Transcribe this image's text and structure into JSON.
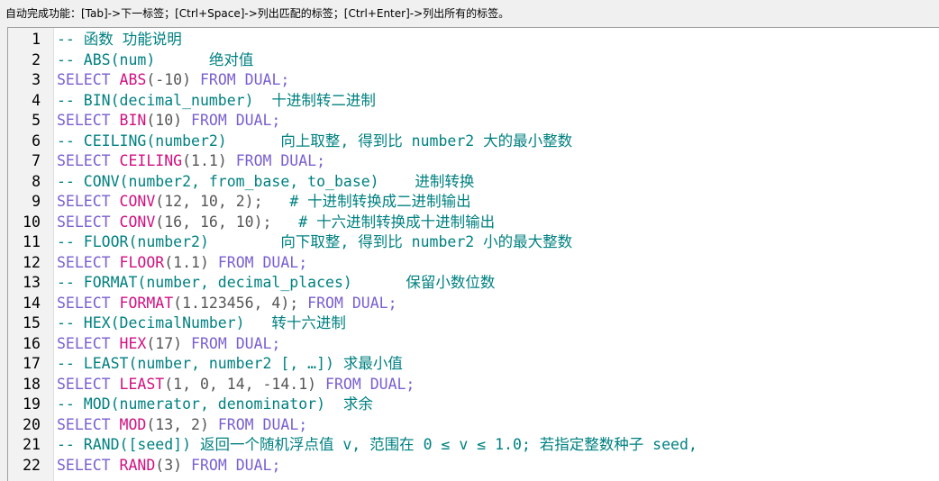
{
  "hint": "自动完成功能：[Tab]->下一标签；[Ctrl+Space]->列出匹配的标签；[Ctrl+Enter]->列出所有的标签。",
  "colors": {
    "comment": "#008080",
    "keyword": "#7a5fd0",
    "function": "#d01080",
    "text": "#555555"
  },
  "lines": [
    {
      "no": "1",
      "segs": [
        [
          "c",
          "-- 函数 功能说明"
        ]
      ]
    },
    {
      "no": "2",
      "segs": [
        [
          "c",
          "-- ABS(num)      绝对值"
        ]
      ]
    },
    {
      "no": "3",
      "segs": [
        [
          "k",
          "SELECT "
        ],
        [
          "f",
          "ABS"
        ],
        [
          "n",
          "(-10) "
        ],
        [
          "k",
          "FROM DUAL;"
        ]
      ]
    },
    {
      "no": "4",
      "segs": [
        [
          "c",
          "-- BIN(decimal_number)  十进制转二进制"
        ]
      ]
    },
    {
      "no": "5",
      "segs": [
        [
          "k",
          "SELECT "
        ],
        [
          "f",
          "BIN"
        ],
        [
          "n",
          "(10) "
        ],
        [
          "k",
          "FROM DUAL;"
        ]
      ]
    },
    {
      "no": "6",
      "segs": [
        [
          "c",
          "-- CEILING(number2)      向上取整, 得到比 number2 大的最小整数"
        ]
      ]
    },
    {
      "no": "7",
      "segs": [
        [
          "k",
          "SELECT "
        ],
        [
          "f",
          "CEILING"
        ],
        [
          "n",
          "(1.1) "
        ],
        [
          "k",
          "FROM DUAL;"
        ]
      ]
    },
    {
      "no": "8",
      "segs": [
        [
          "c",
          "-- CONV(number2, from_base, to_base)    进制转换"
        ]
      ]
    },
    {
      "no": "9",
      "segs": [
        [
          "k",
          "SELECT "
        ],
        [
          "f",
          "CONV"
        ],
        [
          "n",
          "(12, 10, 2);   "
        ],
        [
          "c",
          "# 十进制转换成二进制输出"
        ]
      ]
    },
    {
      "no": "10",
      "segs": [
        [
          "k",
          "SELECT "
        ],
        [
          "f",
          "CONV"
        ],
        [
          "n",
          "(16, 16, 10);   "
        ],
        [
          "c",
          "# 十六进制转换成十进制输出"
        ]
      ]
    },
    {
      "no": "11",
      "segs": [
        [
          "c",
          "-- FLOOR(number2)        向下取整, 得到比 number2 小的最大整数"
        ]
      ]
    },
    {
      "no": "12",
      "segs": [
        [
          "k",
          "SELECT "
        ],
        [
          "f",
          "FLOOR"
        ],
        [
          "n",
          "(1.1) "
        ],
        [
          "k",
          "FROM DUAL;"
        ]
      ]
    },
    {
      "no": "13",
      "segs": [
        [
          "c",
          "-- FORMAT(number, decimal_places)      保留小数位数"
        ]
      ]
    },
    {
      "no": "14",
      "segs": [
        [
          "k",
          "SELECT "
        ],
        [
          "f",
          "FORMAT"
        ],
        [
          "n",
          "(1.123456, 4); "
        ],
        [
          "k",
          "FROM DUAL;"
        ]
      ]
    },
    {
      "no": "15",
      "segs": [
        [
          "c",
          "-- HEX(DecimalNumber)   转十六进制"
        ]
      ]
    },
    {
      "no": "16",
      "segs": [
        [
          "k",
          "SELECT "
        ],
        [
          "f",
          "HEX"
        ],
        [
          "n",
          "(17) "
        ],
        [
          "k",
          "FROM DUAL;"
        ]
      ]
    },
    {
      "no": "17",
      "segs": [
        [
          "c",
          "-- LEAST(number, number2 [, …]) 求最小值"
        ]
      ]
    },
    {
      "no": "18",
      "segs": [
        [
          "k",
          "SELECT "
        ],
        [
          "f",
          "LEAST"
        ],
        [
          "n",
          "(1, 0, 14, -14.1) "
        ],
        [
          "k",
          "FROM DUAL;"
        ]
      ]
    },
    {
      "no": "19",
      "segs": [
        [
          "c",
          "-- MOD(numerator, denominator)  求余"
        ]
      ]
    },
    {
      "no": "20",
      "segs": [
        [
          "k",
          "SELECT "
        ],
        [
          "f",
          "MOD"
        ],
        [
          "n",
          "(13, 2) "
        ],
        [
          "k",
          "FROM DUAL;"
        ]
      ]
    },
    {
      "no": "21",
      "segs": [
        [
          "c",
          "-- RAND([seed]) 返回一个随机浮点值 v, 范围在 0 ≤ v ≤ 1.0; 若指定整数种子 seed,"
        ]
      ]
    },
    {
      "no": "22",
      "segs": [
        [
          "k",
          "SELECT "
        ],
        [
          "f",
          "RAND"
        ],
        [
          "n",
          "(3) "
        ],
        [
          "k",
          "FROM DUAL;"
        ]
      ]
    }
  ]
}
